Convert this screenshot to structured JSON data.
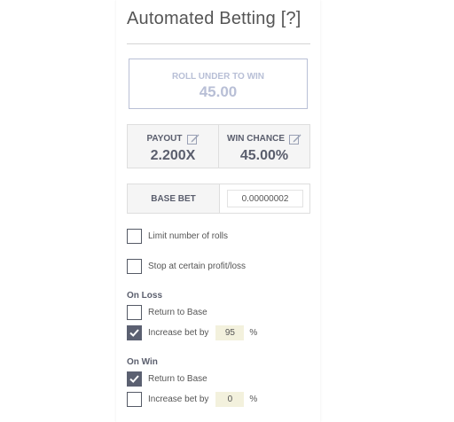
{
  "title": "Automated Betting [?]",
  "roll": {
    "label": "ROLL UNDER TO WIN",
    "value": "45.00"
  },
  "payout": {
    "label": "PAYOUT",
    "value": "2.200X"
  },
  "win_chance": {
    "label": "WIN CHANCE",
    "value": "45.00%"
  },
  "base_bet": {
    "label": "BASE BET",
    "value": "0.00000002"
  },
  "options": {
    "limit_rolls": {
      "label": "Limit number of rolls",
      "checked": false
    },
    "stop_profit_loss": {
      "label": "Stop at certain profit/loss",
      "checked": false
    }
  },
  "on_loss": {
    "heading": "On Loss",
    "return_to_base": {
      "label": "Return to Base",
      "checked": false
    },
    "increase": {
      "label": "Increase bet by",
      "checked": true,
      "value": "95",
      "unit": "%"
    }
  },
  "on_win": {
    "heading": "On Win",
    "return_to_base": {
      "label": "Return to Base",
      "checked": true
    },
    "increase": {
      "label": "Increase bet by",
      "checked": false,
      "value": "0",
      "unit": "%"
    }
  },
  "colors": {
    "accent": "#5b6071",
    "roll_text": "#b8bfd6",
    "field_bg": "#f3f1dd"
  },
  "icons": {
    "edit": "pencil-edit-icon",
    "check": "checkmark-icon"
  }
}
